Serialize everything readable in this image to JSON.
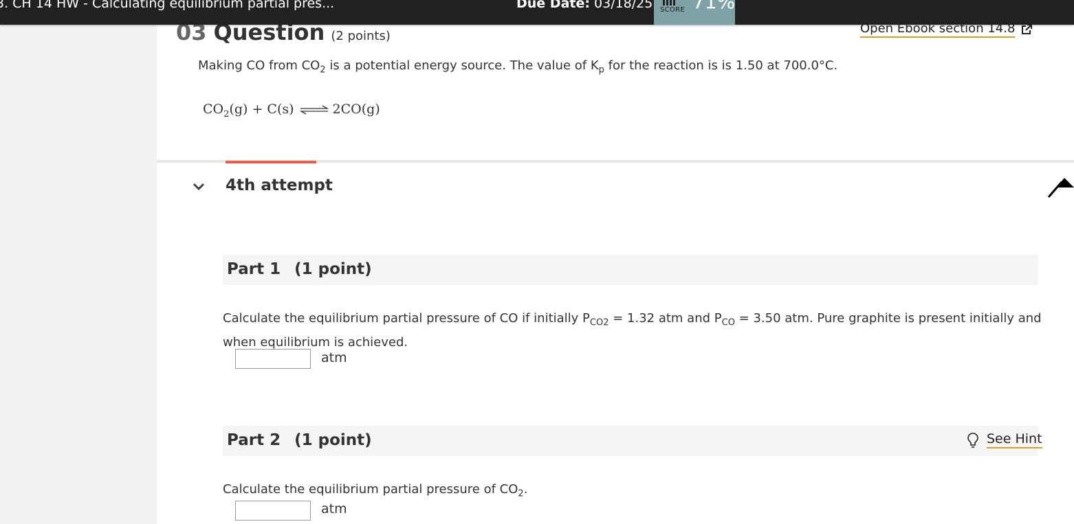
{
  "topbar": {
    "assignment_title": "3. CH 14 HW - Calculating equilibrium partial pres...",
    "due_label": "Due Date:",
    "due_date": "03/18/25",
    "score_label": "SCORE",
    "score_value": "71%"
  },
  "question": {
    "number": "03",
    "label": "Question",
    "points": "(2 points)",
    "ebook_link": "Open Ebook section  14.8",
    "intro_part1": "Making CO from CO",
    "intro_sub1": "2",
    "intro_part2": " is a potential energy source. The value of K",
    "intro_sub2": "p",
    "intro_part3": " for the reaction is is 1.50 at 700.0°C.",
    "equation": {
      "reactant1": "CO",
      "reactant1_sub": "2",
      "reactant1_state": "(g)",
      "plus": "+",
      "reactant2": "C(s)",
      "product": "2CO(g)"
    }
  },
  "attempt": {
    "label": "4th attempt"
  },
  "parts": [
    {
      "title": "Part 1",
      "points": "(1 point)",
      "text_a": "Calculate the equilibrium partial pressure of CO if initially P",
      "sub_a": "CO2",
      "text_b": " = 1.32  atm and P",
      "sub_b": "CO",
      "text_c": " = 3.50 atm. Pure graphite is present initially and",
      "text_d": "when equilibrium is achieved.",
      "unit": "atm",
      "answer_value": ""
    },
    {
      "title": "Part 2",
      "points": "(1 point)",
      "hint_label": "See Hint",
      "text_a": "Calculate the equilibrium partial pressure of CO",
      "sub_a": "2",
      "text_b": ".",
      "unit": "atm",
      "answer_value": ""
    }
  ],
  "colors": {
    "topbar": "#212121",
    "score_bg": "#7fa2a6",
    "accent_tab": "#e8604a",
    "link_underline": "#d4a02a",
    "sidebar": "#f2f2f2"
  },
  "icons": [
    "score-chart-icon",
    "external-link-icon",
    "chevron-down-icon",
    "lightbulb-icon",
    "cursor-arrow-icon"
  ]
}
